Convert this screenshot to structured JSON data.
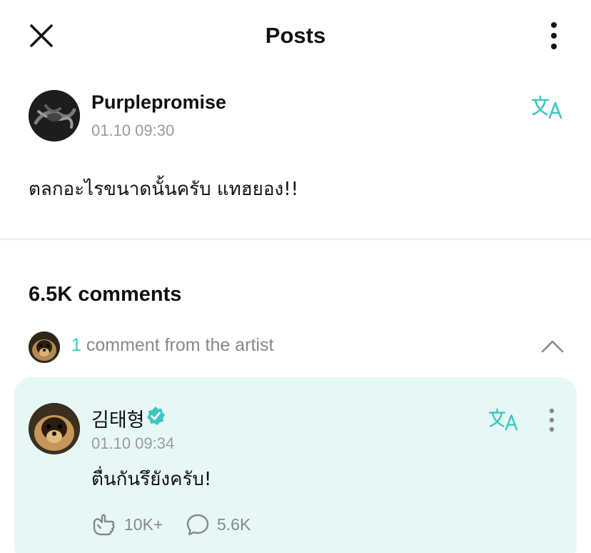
{
  "header": {
    "title": "Posts",
    "close_icon": "close-icon",
    "more_icon": "vertical-dots-icon"
  },
  "post": {
    "author": "Purplepromise",
    "timestamp": "01.10 09:30",
    "text": "ตลกอะไรขนาดนั้นครับ แทฮยอง!!",
    "translate_icon": "translate-icon"
  },
  "comments": {
    "count_label": "6.5K comments",
    "artist_summary": {
      "count": "1",
      "label": " comment from the artist",
      "expanded": true
    },
    "items": [
      {
        "author": "김태형",
        "verified": true,
        "timestamp": "01.10 09:34",
        "text": "ตื่นกันรึยังครับ!",
        "likes": "10K+",
        "replies": "5.6K"
      }
    ]
  },
  "colors": {
    "accent": "#3ec6c2",
    "artist_card_bg": "#e6f8f6",
    "muted_text": "#9a9a9a"
  }
}
